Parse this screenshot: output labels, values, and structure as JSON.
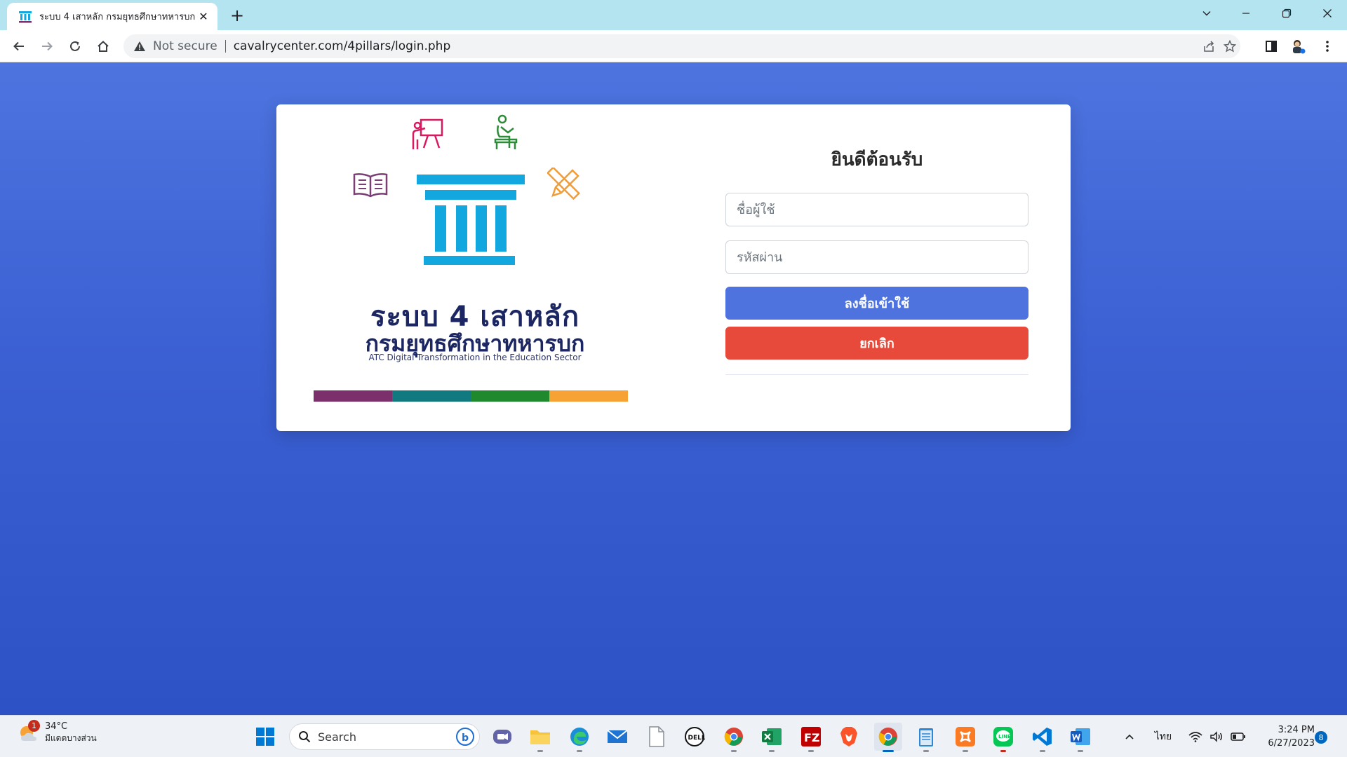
{
  "browser": {
    "tab": {
      "title": "ระบบ 4 เสาหลัก กรมยุทธศึกษาทหารบก",
      "close": "✕"
    },
    "new_tab": "+",
    "address": {
      "security_label": "Not secure",
      "url": "cavalrycenter.com/4pillars/login.php"
    }
  },
  "logo": {
    "title_line1": "ระบบ 4 เสาหลัก",
    "title_line2": "กรมยุทธศึกษาทหารบก",
    "tagline": "ATC Digital Transformation in the Education Sector",
    "stripe_colors": [
      "#7b2f6b",
      "#117a80",
      "#1f8a2d",
      "#f7a234"
    ],
    "icon_colors": {
      "teacher": "#d81b60",
      "student": "#2e8b3a",
      "book": "#7b3f75",
      "tools": "#f39c34",
      "pillar": "#12a8df"
    }
  },
  "login": {
    "heading": "ยินดีต้อนรับ",
    "username_placeholder": "ชื่อผู้ใช้",
    "password_placeholder": "รหัสผ่าน",
    "submit_label": "ลงชื่อเข้าใช้",
    "cancel_label": "ยกเลิก",
    "colors": {
      "submit": "#4e73df",
      "cancel": "#e74a3b"
    }
  },
  "taskbar": {
    "weather": {
      "badge": "1",
      "temp": "34°C",
      "desc": "มีแดดบางส่วน"
    },
    "search_label": "Search",
    "language": "ไทย",
    "time": "3:24 PM",
    "date": "6/27/2023",
    "notifications": "8"
  }
}
